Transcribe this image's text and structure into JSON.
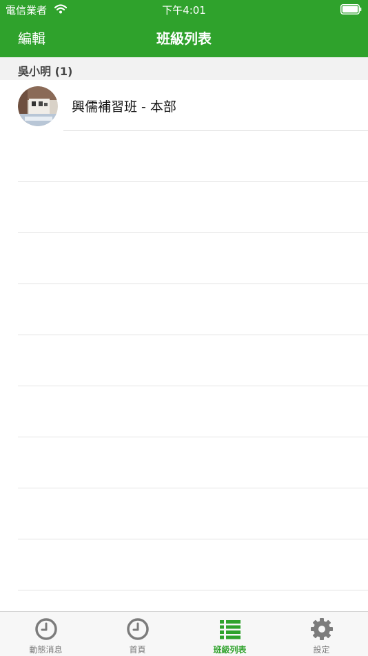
{
  "status_bar": {
    "carrier": "電信業者",
    "time": "下午4:01"
  },
  "nav": {
    "edit_label": "編輯",
    "title": "班級列表"
  },
  "section": {
    "title": "吳小明 (1)"
  },
  "classes": [
    {
      "name": "興儒補習班 - 本部"
    }
  ],
  "tabs": [
    {
      "label": "動態消息",
      "icon": "clock-icon",
      "active": false
    },
    {
      "label": "首頁",
      "icon": "clock-icon",
      "active": false
    },
    {
      "label": "班級列表",
      "icon": "list-icon",
      "active": true
    },
    {
      "label": "設定",
      "icon": "gear-icon",
      "active": false
    }
  ],
  "colors": {
    "accent": "#2fa22c",
    "inactive": "#7c7c7c"
  }
}
